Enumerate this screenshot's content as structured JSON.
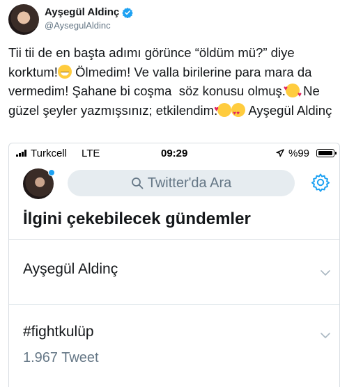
{
  "tweet": {
    "display_name": "Ayşegül Aldinç",
    "handle": "@AysegulAldinc",
    "verified_icon": "verified-badge-icon",
    "text": {
      "p1": "Tii tii de en başta adımı görünce “öldüm mü?” diye korktum!",
      "p2": " Ölmedim! Ve valla birilerine para mara da vermedim! Şahane bi coşma  söz konusu olmuş.",
      "p3": " Ne güzel şeyler yazmışsınız; etkilendim.",
      "p4": " Ayşegül Aldinç"
    }
  },
  "phone": {
    "status_bar": {
      "carrier": "Turkcell",
      "network": "LTE",
      "time": "09:29",
      "battery": "%99"
    },
    "search_placeholder": "Twitter'da Ara",
    "section_title": "İlgini çekebilecek gündemler",
    "trends": [
      {
        "title": "Ayşegül Aldinç",
        "meta": ""
      },
      {
        "title": "#fightkulüp",
        "meta": "1.967 Tweet"
      }
    ]
  },
  "colors": {
    "accent": "#1da1f2",
    "muted_text": "#657786",
    "search_bg": "#e6ecf0"
  }
}
